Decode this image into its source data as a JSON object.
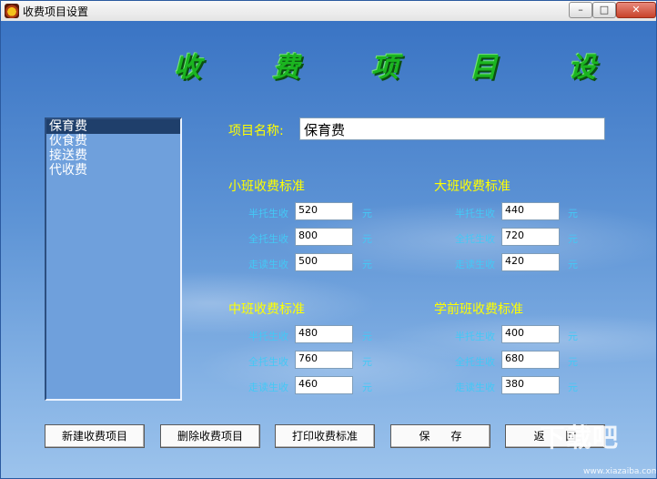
{
  "window": {
    "title": "收费项目设置"
  },
  "header": {
    "title": "收 费 项 目 设 置"
  },
  "list": {
    "items": [
      "保育费",
      "伙食费",
      "接送费",
      "代收费"
    ],
    "selected_index": 0
  },
  "item_name": {
    "label": "项目名称:",
    "value": "保育费"
  },
  "groups": [
    {
      "title": "小班收费标准",
      "rows": [
        {
          "label": "半托生收",
          "value": "520",
          "unit": "元"
        },
        {
          "label": "全托生收",
          "value": "800",
          "unit": "元"
        },
        {
          "label": "走读生收",
          "value": "500",
          "unit": "元"
        }
      ]
    },
    {
      "title": "大班收费标准",
      "rows": [
        {
          "label": "半托生收",
          "value": "440",
          "unit": "元"
        },
        {
          "label": "全托生收",
          "value": "720",
          "unit": "元"
        },
        {
          "label": "走读生收",
          "value": "420",
          "unit": "元"
        }
      ]
    },
    {
      "title": "中班收费标准",
      "rows": [
        {
          "label": "半托生收",
          "value": "480",
          "unit": "元"
        },
        {
          "label": "全托生收",
          "value": "760",
          "unit": "元"
        },
        {
          "label": "走读生收",
          "value": "460",
          "unit": "元"
        }
      ]
    },
    {
      "title": "学前班收费标准",
      "rows": [
        {
          "label": "半托生收",
          "value": "400",
          "unit": "元"
        },
        {
          "label": "全托生收",
          "value": "680",
          "unit": "元"
        },
        {
          "label": "走读生收",
          "value": "380",
          "unit": "元"
        }
      ]
    }
  ],
  "buttons": {
    "new": "新建收费项目",
    "delete": "删除收费项目",
    "print": "打印收费标准",
    "save": "保      存",
    "back": "返      回"
  },
  "watermark": {
    "text": "下载吧",
    "url": "www.xiazaiba.com"
  },
  "colors": {
    "group_title": "#ffff00",
    "row_label": "#44c8f5",
    "header_title": "#1bb520",
    "selected_item": "#1f3f6b",
    "background": "#3f79c8"
  },
  "icons": {
    "app": "sunflower-icon",
    "minimize": "minimize-icon",
    "maximize": "maximize-icon",
    "close": "close-icon"
  }
}
